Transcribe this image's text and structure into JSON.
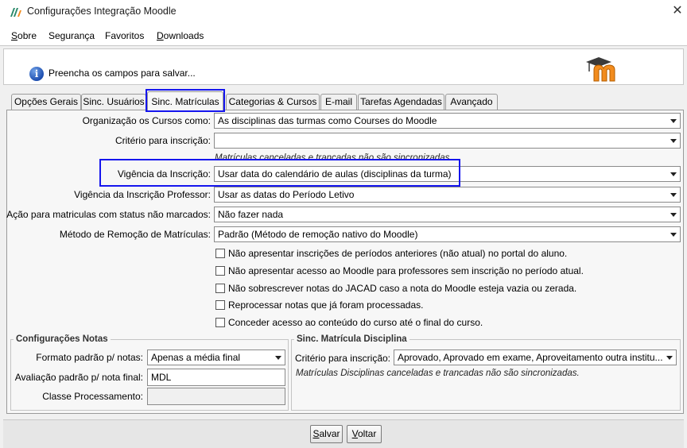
{
  "window": {
    "title": "Configurações Integração Moodle",
    "close_glyph": "✕",
    "icon": "moodle-integration-app-icon"
  },
  "menu": [
    {
      "mnemonic": "S",
      "rest": "obre"
    },
    {
      "mnemonic": "",
      "rest": "Segurança"
    },
    {
      "mnemonic": "",
      "rest": "Favoritos"
    },
    {
      "mnemonic": "D",
      "rest": "ownloads"
    }
  ],
  "info": {
    "text": "Preencha os campos para salvar...",
    "icon": "info-icon",
    "logo": "moodle-logo"
  },
  "tabs": [
    {
      "label": "Opções Gerais"
    },
    {
      "label": "Sinc. Usuários"
    },
    {
      "label": "Sinc. Matrículas",
      "active": true
    },
    {
      "label": "Categorias & Cursos"
    },
    {
      "label": "E-mail"
    },
    {
      "label": "Tarefas Agendadas"
    },
    {
      "label": "Avançado"
    }
  ],
  "form": {
    "org_cursos": {
      "label": "Organização os Cursos como:",
      "value": "As disciplinas das turmas como Courses do Moodle"
    },
    "criterio": {
      "label": "Critério para inscrição:",
      "value": ""
    },
    "criterio_note": "Matrículas canceladas e trancadas não são sincronizadas.",
    "vigencia": {
      "label": "Vigência da Inscrição:",
      "value": "Usar data do calendário de aulas (disciplinas da turma)"
    },
    "vigencia_prof": {
      "label": "Vigência da Inscrição Professor:",
      "value": "Usar as datas do Período Letivo"
    },
    "acao_status": {
      "label": "Ação para matriculas com status não marcados:",
      "value": "Não fazer nada"
    },
    "metodo_remocao": {
      "label": "Método de Remoção de Matrículas:",
      "value": "Padrão (Método de remoção nativo do Moodle)"
    },
    "checkboxes": [
      {
        "label": "Não apresentar inscrições de períodos anteriores (não atual) no portal do aluno.",
        "checked": false
      },
      {
        "label": "Não apresentar acesso ao Moodle para professores sem inscrição no período atual.",
        "checked": false
      },
      {
        "label": "Não sobrescrever notas do JACAD caso a nota do Moodle esteja vazia ou zerada.",
        "checked": false
      },
      {
        "label": "Reprocessar notas que já foram processadas.",
        "checked": false
      },
      {
        "label": "Conceder acesso ao conteúdo do curso até o final do curso.",
        "checked": false
      }
    ]
  },
  "notas": {
    "title": "Configurações Notas",
    "formato": {
      "label": "Formato padrão p/ notas:",
      "value": "Apenas a média final"
    },
    "avaliacao": {
      "label": "Avaliação padrão p/ nota final:",
      "value": "MDL"
    },
    "classe": {
      "label": "Classe Processamento:",
      "value": ""
    }
  },
  "disciplina": {
    "title": "Sinc. Matrícula Disciplina",
    "criterio": {
      "label": "Critério para inscrição:",
      "value": "Aprovado, Aprovado em exame, Aproveitamento outra institu..."
    },
    "note": "Matrículas Disciplinas canceladas e trancadas não são sincronizadas."
  },
  "buttons": {
    "save": {
      "mnemonic": "S",
      "rest": "alvar"
    },
    "back": {
      "mnemonic": "V",
      "rest": "oltar"
    }
  },
  "colors": {
    "highlight": "#1515ee",
    "info_blue": "#1e4fb0",
    "moodle_orange": "#f28c1e"
  }
}
